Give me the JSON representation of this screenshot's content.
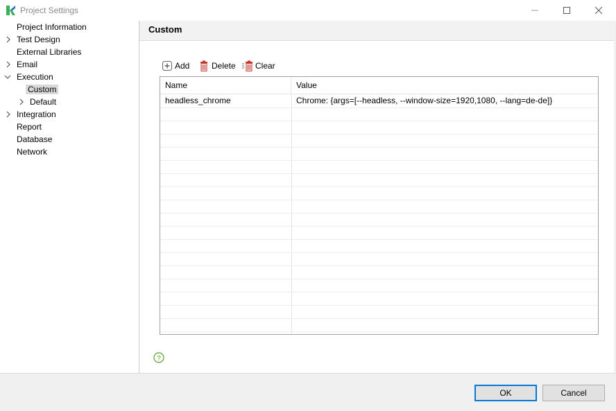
{
  "window": {
    "title": "Project Settings",
    "controls": {
      "minimize": "minimize-icon",
      "maximize": "maximize-icon",
      "close": "close-icon"
    }
  },
  "tree": {
    "items": [
      {
        "label": "Project Information",
        "expander": "none"
      },
      {
        "label": "Test Design",
        "expander": "collapsed"
      },
      {
        "label": "External Libraries",
        "expander": "none"
      },
      {
        "label": "Email",
        "expander": "collapsed"
      },
      {
        "label": "Execution",
        "expander": "expanded"
      },
      {
        "label": "Custom",
        "expander": "none",
        "selected": true
      },
      {
        "label": "Default",
        "expander": "collapsed"
      },
      {
        "label": "Integration",
        "expander": "collapsed"
      },
      {
        "label": "Report",
        "expander": "none"
      },
      {
        "label": "Database",
        "expander": "none"
      },
      {
        "label": "Network",
        "expander": "none"
      }
    ]
  },
  "main": {
    "title": "Custom",
    "toolbar": {
      "add_label": "Add",
      "delete_label": "Delete",
      "clear_label": "Clear"
    },
    "table": {
      "columns": [
        "Name",
        "Value"
      ],
      "rows": [
        {
          "name": "headless_chrome",
          "value": "Chrome: {args=[--headless, --window-size=1920,1080, --lang=de-de]}"
        }
      ]
    }
  },
  "buttons": {
    "ok_label": "OK",
    "cancel_label": "Cancel"
  },
  "colors": {
    "accent": "#0078d7",
    "selection": "#d9d9d9",
    "delete_red": "#c0392b",
    "help_green": "#5aa02c",
    "logo_green": "#3dae5a",
    "logo_blue": "#1f78c8"
  }
}
